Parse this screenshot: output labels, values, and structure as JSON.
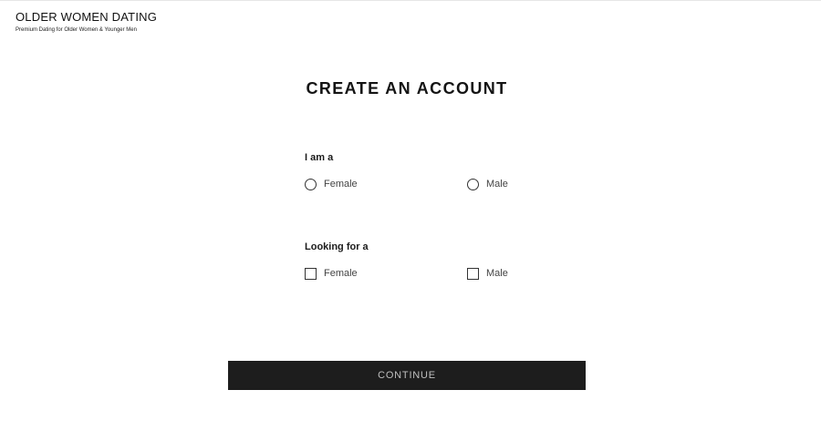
{
  "brand": {
    "name": "OLDER WOMEN DATING",
    "tagline": "Premium Dating for Older Women & Younger Men"
  },
  "page_title": "CREATE AN ACCOUNT",
  "i_am": {
    "label": "I am a",
    "options": [
      {
        "label": "Female",
        "type": "radio",
        "checked": false
      },
      {
        "label": "Male",
        "type": "radio",
        "checked": false
      }
    ]
  },
  "looking_for": {
    "label": "Looking for a",
    "options": [
      {
        "label": "Female",
        "type": "checkbox",
        "checked": false
      },
      {
        "label": "Male",
        "type": "checkbox",
        "checked": false
      }
    ]
  },
  "continue_label": "CONTINUE",
  "colors": {
    "button_bg": "#1d1d1d",
    "button_text": "#bfbfbf",
    "text": "#1b1b1b"
  }
}
